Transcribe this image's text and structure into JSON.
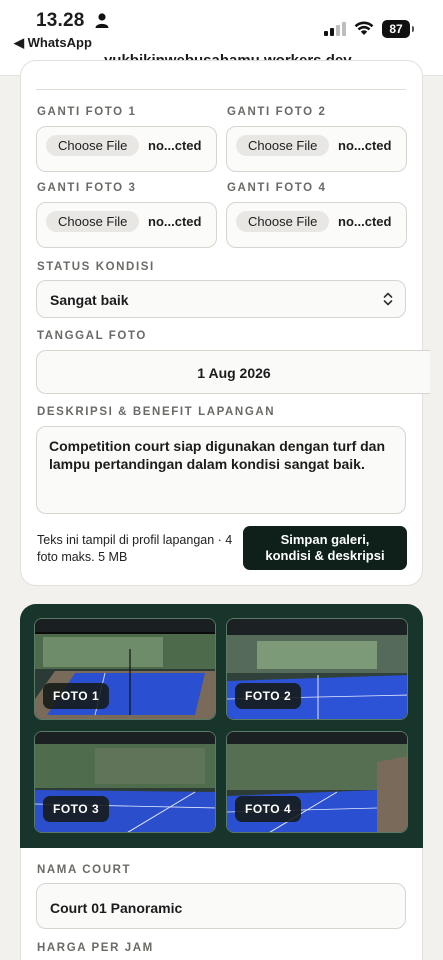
{
  "status_bar": {
    "time": "13.28",
    "back_app": "◀ WhatsApp",
    "url": "...yukbikinwebusahamu.workers.dev",
    "battery": "87"
  },
  "photo_uploads": [
    {
      "label": "GANTI FOTO 1",
      "button": "Choose File",
      "file": "no...cted"
    },
    {
      "label": "GANTI FOTO 2",
      "button": "Choose File",
      "file": "no...cted"
    },
    {
      "label": "GANTI FOTO 3",
      "button": "Choose File",
      "file": "no...cted"
    },
    {
      "label": "GANTI FOTO 4",
      "button": "Choose File",
      "file": "no...cted"
    }
  ],
  "status": {
    "label": "STATUS KONDISI",
    "value": "Sangat baik"
  },
  "date": {
    "label": "TANGGAL FOTO",
    "value": "1 Aug 2026"
  },
  "description": {
    "label": "DESKRIPSI & BENEFIT LAPANGAN",
    "value": "Competition court siap digunakan dengan turf dan lampu pertandingan dalam kondisi sangat baik."
  },
  "help_text": "Teks ini tampil di profil lapangan · 4 foto maks. 5 MB",
  "save_button": {
    "line1": "Simpan galeri,",
    "line2": "kondisi & deskripsi"
  },
  "gallery": [
    {
      "badge": "FOTO 1"
    },
    {
      "badge": "FOTO 2"
    },
    {
      "badge": "FOTO 3"
    },
    {
      "badge": "FOTO 4"
    }
  ],
  "court_name": {
    "label": "NAMA COURT",
    "value": "Court 01 Panoramic"
  },
  "price": {
    "label": "HARGA PER JAM"
  },
  "colors": {
    "primary_dark": "#0f1f19",
    "gallery_bg": "#17352b",
    "court_blue": "#2a4fd0"
  }
}
